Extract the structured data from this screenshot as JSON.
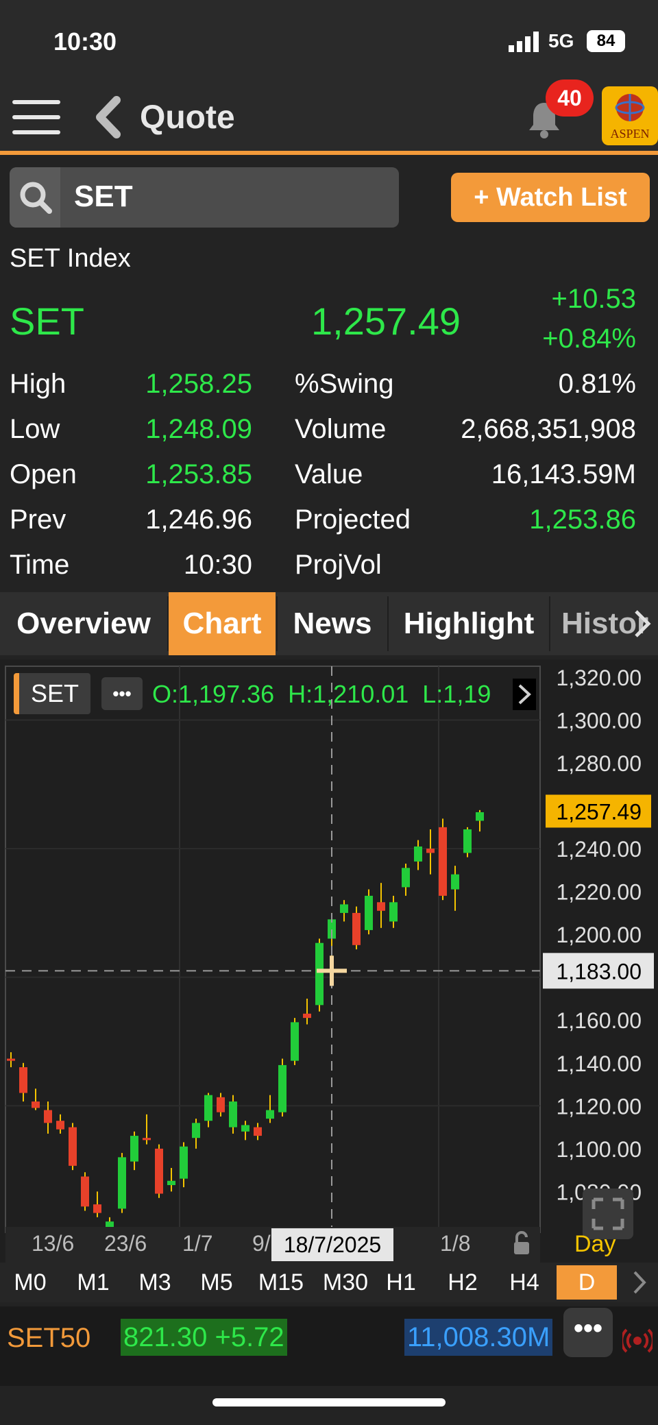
{
  "status_bar": {
    "time": "10:30",
    "network": "5G",
    "battery": "84"
  },
  "header": {
    "title": "Quote",
    "notifications": "40",
    "logo_text": "ASPEN"
  },
  "search": {
    "value": "SET",
    "watchlist_label": "+ Watch List"
  },
  "quote": {
    "index_name": "SET Index",
    "symbol": "SET",
    "last": "1,257.49",
    "change": "+10.53",
    "percent": "+0.84%"
  },
  "stats": {
    "left": [
      {
        "label": "High",
        "value": "1,258.25"
      },
      {
        "label": "Low",
        "value": "1,248.09"
      },
      {
        "label": "Open",
        "value": "1,253.85"
      },
      {
        "label": "Prev",
        "value": "1,246.96"
      },
      {
        "label": "Time",
        "value": "10:30"
      }
    ],
    "right": [
      {
        "label": "%Swing",
        "value": "0.81%"
      },
      {
        "label": "Volume",
        "value": "2,668,351,908"
      },
      {
        "label": "Value",
        "value": "16,143.59M"
      },
      {
        "label": "Projected",
        "value": "1,253.86"
      },
      {
        "label": "ProjVol",
        "value": ""
      }
    ]
  },
  "tabs": [
    "Overview",
    "Chart",
    "News",
    "Highlight",
    "Histor"
  ],
  "chart": {
    "symbol_chip": "SET",
    "more_chip": "•••",
    "ohlc": "O:1,197.36  H:1,210.01  L:1,19",
    "price_labels": [
      "1,320.00",
      "1,300.00",
      "1,280.00",
      "1,257.49",
      "1,240.00",
      "1,220.00",
      "1,200.00",
      "1,183.00",
      "1,160.00",
      "1,140.00",
      "1,120.00",
      "1,100.00",
      "1,080.00"
    ],
    "date_labels": [
      "13/6",
      "23/6",
      "1/7",
      "9/",
      "1/8"
    ],
    "crosshair_date": "18/7/2025",
    "period": "Day",
    "colors": {
      "up": "#22cc3a",
      "down": "#e8412a",
      "current_price_bg": "#f5b400",
      "crosshair_bg": "#e6e6e6"
    }
  },
  "chart_data": {
    "type": "candlestick",
    "ylim": [
      1070,
      1320
    ],
    "candles": [
      {
        "o": 1142,
        "h": 1145,
        "l": 1138,
        "c": 1141
      },
      {
        "o": 1138,
        "h": 1140,
        "l": 1122,
        "c": 1126
      },
      {
        "o": 1122,
        "h": 1128,
        "l": 1118,
        "c": 1119
      },
      {
        "o": 1118,
        "h": 1122,
        "l": 1107,
        "c": 1112
      },
      {
        "o": 1113,
        "h": 1116,
        "l": 1107,
        "c": 1109
      },
      {
        "o": 1110,
        "h": 1112,
        "l": 1090,
        "c": 1092
      },
      {
        "o": 1087,
        "h": 1089,
        "l": 1071,
        "c": 1073
      },
      {
        "o": 1074,
        "h": 1080,
        "l": 1068,
        "c": 1070
      },
      {
        "o": 1063,
        "h": 1068,
        "l": 1058,
        "c": 1066
      },
      {
        "o": 1072,
        "h": 1098,
        "l": 1070,
        "c": 1096
      },
      {
        "o": 1094,
        "h": 1108,
        "l": 1090,
        "c": 1106
      },
      {
        "o": 1105,
        "h": 1116,
        "l": 1102,
        "c": 1104
      },
      {
        "o": 1100,
        "h": 1102,
        "l": 1077,
        "c": 1079
      },
      {
        "o": 1083,
        "h": 1091,
        "l": 1080,
        "c": 1085
      },
      {
        "o": 1086,
        "h": 1103,
        "l": 1082,
        "c": 1101
      },
      {
        "o": 1105,
        "h": 1114,
        "l": 1100,
        "c": 1112
      },
      {
        "o": 1113,
        "h": 1126,
        "l": 1110,
        "c": 1125
      },
      {
        "o": 1124,
        "h": 1126,
        "l": 1115,
        "c": 1117
      },
      {
        "o": 1110,
        "h": 1125,
        "l": 1107,
        "c": 1122
      },
      {
        "o": 1108,
        "h": 1113,
        "l": 1104,
        "c": 1111
      },
      {
        "o": 1110,
        "h": 1112,
        "l": 1104,
        "c": 1106
      },
      {
        "o": 1114,
        "h": 1125,
        "l": 1112,
        "c": 1118
      },
      {
        "o": 1117,
        "h": 1142,
        "l": 1115,
        "c": 1139
      },
      {
        "o": 1141,
        "h": 1161,
        "l": 1139,
        "c": 1159
      },
      {
        "o": 1163,
        "h": 1170,
        "l": 1158,
        "c": 1161
      },
      {
        "o": 1167,
        "h": 1198,
        "l": 1164,
        "c": 1196
      },
      {
        "o": 1198,
        "h": 1210,
        "l": 1183,
        "c": 1207
      },
      {
        "o": 1210,
        "h": 1216,
        "l": 1206,
        "c": 1214
      },
      {
        "o": 1210,
        "h": 1213,
        "l": 1193,
        "c": 1195
      },
      {
        "o": 1202,
        "h": 1221,
        "l": 1200,
        "c": 1218
      },
      {
        "o": 1215,
        "h": 1224,
        "l": 1203,
        "c": 1211
      },
      {
        "o": 1206,
        "h": 1218,
        "l": 1203,
        "c": 1215
      },
      {
        "o": 1222,
        "h": 1233,
        "l": 1218,
        "c": 1231
      },
      {
        "o": 1234,
        "h": 1244,
        "l": 1230,
        "c": 1241
      },
      {
        "o": 1240,
        "h": 1249,
        "l": 1228,
        "c": 1238
      },
      {
        "o": 1250,
        "h": 1254,
        "l": 1216,
        "c": 1218
      },
      {
        "o": 1221,
        "h": 1232,
        "l": 1211,
        "c": 1228
      },
      {
        "o": 1238,
        "h": 1250,
        "l": 1236,
        "c": 1249
      },
      {
        "o": 1253,
        "h": 1258,
        "l": 1248,
        "c": 1257
      }
    ],
    "crosshair_price": 1183.0,
    "current_price": 1257.49
  },
  "timeframes": [
    "M0",
    "M1",
    "M3",
    "M5",
    "M15",
    "M30",
    "H1",
    "H2",
    "H4",
    "D"
  ],
  "ticker": {
    "symbol": "SET50",
    "value": "821.30 +5.72",
    "amount": "11,008.30M",
    "more": "•••"
  }
}
